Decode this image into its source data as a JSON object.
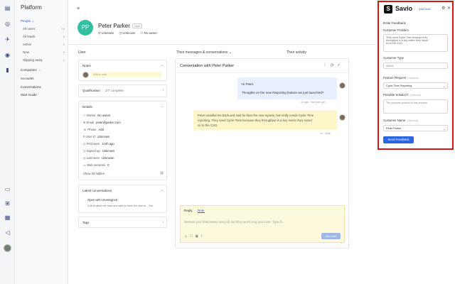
{
  "icon_bar": {
    "icons": [
      "inbox-icon",
      "people-icon",
      "bolt-icon",
      "broadcast-icon",
      "book-icon",
      "chat-icon",
      "grid-icon",
      "notes-icon",
      "megaphone-icon",
      "user-avatar"
    ]
  },
  "nav": {
    "brand": "Platform",
    "people_label": "People ⌄",
    "items": [
      {
        "label": "All users",
        "count": "15"
      },
      {
        "label": "All leads",
        "count": "0"
      },
      {
        "label": "Active",
        "count": "0"
      },
      {
        "label": "New",
        "count": "0"
      },
      {
        "label": "Slipping away",
        "count": "0"
      }
    ],
    "companies_label": "Companies",
    "companies_count": "1",
    "accounts_label": "Accounts",
    "conversations_label": "Conversations",
    "start_guide_label": "Start Guide"
  },
  "profile": {
    "initials": "PP",
    "name": "Peter Parker",
    "badge": "User",
    "meta": [
      "⚲ Unknown",
      "◷ Unknown",
      "⚇ No owner"
    ]
  },
  "columns": {
    "user": "User",
    "messages": "Their messages & conversations ⌄",
    "activity": "Their activity"
  },
  "notes_card": {
    "title": "Notes",
    "placeholder": "Add a note"
  },
  "qualification_card": {
    "title": "Qualification",
    "value": "2/7 complete"
  },
  "details_card": {
    "title": "Details",
    "rows": [
      {
        "label": "Owner",
        "value": "No owner"
      },
      {
        "label": "Email",
        "value": "peter@parker.com"
      },
      {
        "label": "Phone",
        "value": "Add"
      },
      {
        "label": "User id",
        "value": "Unknown"
      },
      {
        "label": "First seen",
        "value": "1mth ago"
      },
      {
        "label": "Signed up",
        "value": "Unknown"
      },
      {
        "label": "Last seen",
        "value": "Unknown"
      },
      {
        "label": "Web sessions",
        "value": "0"
      }
    ],
    "show_hidden": "Show 26 hidden"
  },
  "latest_conv_card": {
    "title": "Latest conversations",
    "line1": "Open with Unassigned",
    "line2": "Call emailed me back and said he likes the new re... Oct"
  },
  "tags_card": {
    "title": "Tags"
  },
  "conversation": {
    "title": "Conversation with Peter Parker",
    "outgoing_line1": "Hi Peter,",
    "outgoing_line2": "Thoughts on the new Reporting feature we just launched?",
    "outgoing_stamp": "1h ago · Not seen yet",
    "incoming_line1": "Peter emailed me back and said he likes the new reports, but really needs Cycle Time",
    "incoming_line2": "reporting. They need Cycle Time because they throughput is a key metric they report",
    "incoming_line3": "on to the CXO.",
    "incoming_stamp": "1h · Note",
    "reply_tab": "Reply",
    "note_tab": "Note",
    "composer_placeholder": "Mention your teammates using @ and they won't ping your note. Type /h...",
    "send_label": "Add note"
  },
  "savio": {
    "name": "Savio",
    "link": "Add Note",
    "section": "Enter Feedback",
    "problem_label": "Customer Problem",
    "problem_text_1": "They need Cycle Time because they",
    "problem_text_2": "throughput is a key metric they report",
    "problem_text_3": "on to the CXO.",
    "type_label": "Customer Type",
    "type_value": "Active",
    "feature_label": "Feature Request",
    "feature_hint": "(Optional)",
    "feature_value": "Cycle Time Reporting",
    "solution_label": "Possible Solution?",
    "solution_hint": "(Optional)",
    "solution_placeholder": "The possible solution to this problem",
    "customer_label": "Customer Name",
    "customer_hint": "(Optional)",
    "customer_value": "Peter Parker",
    "submit_label": "Send Feedback"
  },
  "colors": {
    "accent": "#2a66e0",
    "highlight_border": "#d01818",
    "avatar": "#34c0a0"
  }
}
